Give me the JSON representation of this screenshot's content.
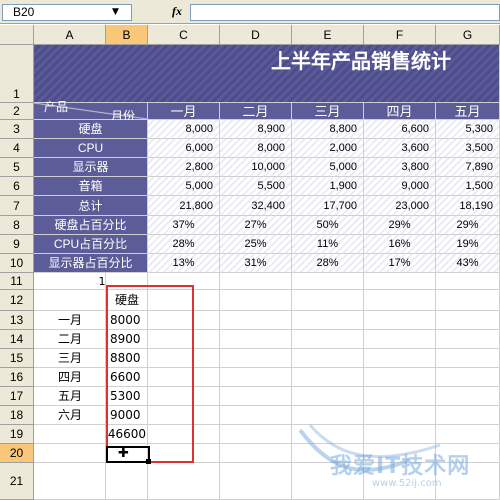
{
  "formula_bar": {
    "cell_ref": "B20",
    "fx_label": "fx",
    "formula": ""
  },
  "columns": [
    "A",
    "B",
    "C",
    "D",
    "E",
    "F",
    "G"
  ],
  "rows": [
    "1",
    "2",
    "3",
    "4",
    "5",
    "6",
    "7",
    "8",
    "9",
    "10",
    "11",
    "12",
    "13",
    "14",
    "15",
    "16",
    "17",
    "18",
    "19",
    "20",
    "21"
  ],
  "sheet": {
    "title": "上半年产品销售统计",
    "header_month": "月份",
    "header_product": "产品",
    "months": [
      "一月",
      "二月",
      "三月",
      "四月",
      "五月"
    ],
    "labels": [
      "硬盘",
      "CPU",
      "显示器",
      "音箱",
      "总计",
      "硬盘占百分比",
      "CPU占百分比",
      "显示器占百分比"
    ],
    "values": [
      [
        "8,000",
        "8,900",
        "8,800",
        "6,600",
        "5,300"
      ],
      [
        "6,000",
        "8,000",
        "2,000",
        "3,600",
        "3,500"
      ],
      [
        "2,800",
        "10,000",
        "5,000",
        "3,800",
        "7,890"
      ],
      [
        "5,000",
        "5,500",
        "1,900",
        "9,000",
        "1,500"
      ],
      [
        "21,800",
        "32,400",
        "17,700",
        "23,000",
        "18,190"
      ],
      [
        "37%",
        "27%",
        "50%",
        "29%",
        "29%"
      ],
      [
        "28%",
        "25%",
        "11%",
        "16%",
        "19%"
      ],
      [
        "13%",
        "31%",
        "28%",
        "17%",
        "43%"
      ]
    ],
    "row11_b": "1",
    "sub_header": "硬盘",
    "sub_months": [
      "一月",
      "二月",
      "三月",
      "四月",
      "五月",
      "六月"
    ],
    "sub_values": [
      "8000",
      "8900",
      "8800",
      "6600",
      "5300",
      "9000"
    ],
    "sub_total": "46600"
  },
  "watermark": {
    "text": "我爱IT技术网",
    "url": "www.52ij.com"
  },
  "colors": {
    "header_fill": "#5c5c98",
    "highlight_border": "#e03030",
    "selected_header": "#f9c77a"
  }
}
